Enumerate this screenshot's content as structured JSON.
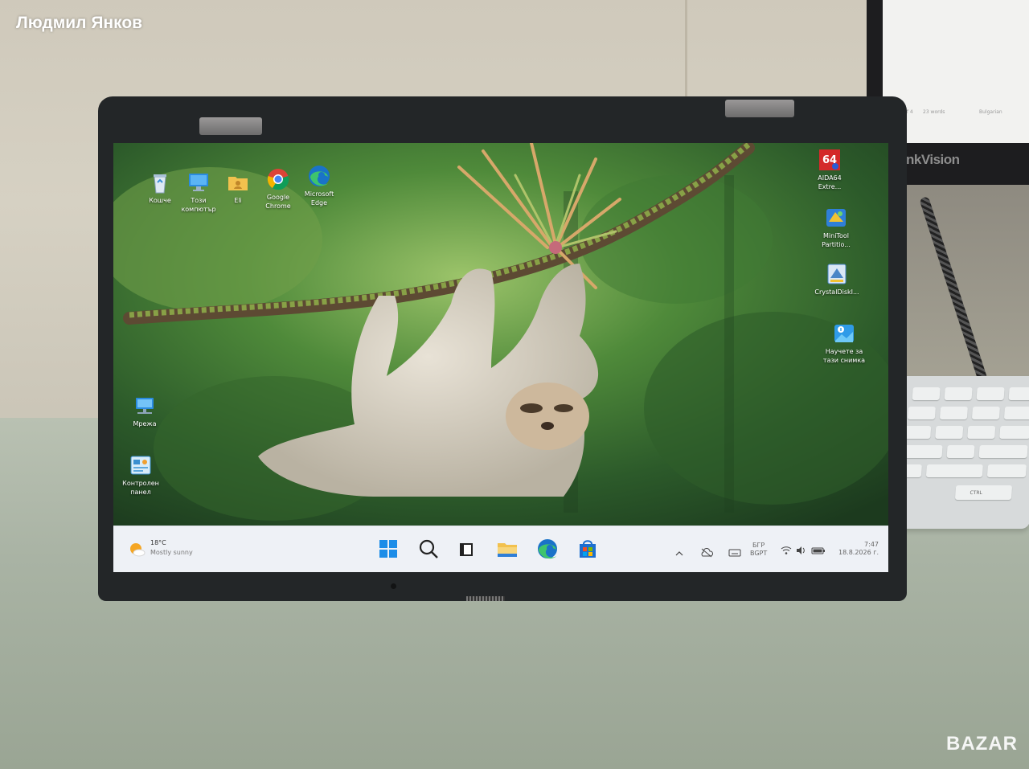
{
  "photo": {
    "watermark_top": "Людмил Янков",
    "watermark_bottom": "BAZAR",
    "external_monitor": {
      "brand": "ThinkVision",
      "screen_texts": [
        "Page 4 of 4",
        "23 words",
        "Bulgarian"
      ]
    },
    "keyboard_keys": [
      "CTRL"
    ]
  },
  "desktop": {
    "left_icons": [
      {
        "name": "recycle-bin",
        "label": "Кошче"
      },
      {
        "name": "this-pc",
        "label": "Този\nкомпютър"
      },
      {
        "name": "user-folder",
        "label": "Eli"
      },
      {
        "name": "google-chrome",
        "label": "Google\nChrome"
      },
      {
        "name": "microsoft-edge",
        "label": "Microsoft\nEdge"
      },
      {
        "name": "network",
        "label": "Мрежа"
      },
      {
        "name": "control-panel",
        "label": "Контролен\nпанел"
      }
    ],
    "right_icons": [
      {
        "name": "aida64",
        "label": "AIDA64\nExtre...",
        "badge": "64"
      },
      {
        "name": "minitool-partition",
        "label": "MiniTool\nPartitio..."
      },
      {
        "name": "crystaldisk",
        "label": "CrystalDiskI..."
      },
      {
        "name": "learn-about-picture",
        "label": "Научете за\nтази снимка"
      }
    ]
  },
  "taskbar": {
    "weather": {
      "temp": "18°C",
      "desc": "Mostly sunny"
    },
    "apps": [
      "start-icon",
      "search-icon",
      "task-view-icon",
      "file-explorer-icon",
      "edge-icon",
      "store-icon"
    ],
    "tray": {
      "lang_top": "БГР",
      "lang_bottom": "BGPT",
      "time": "7:47",
      "date": "18.8.2026 г."
    }
  }
}
